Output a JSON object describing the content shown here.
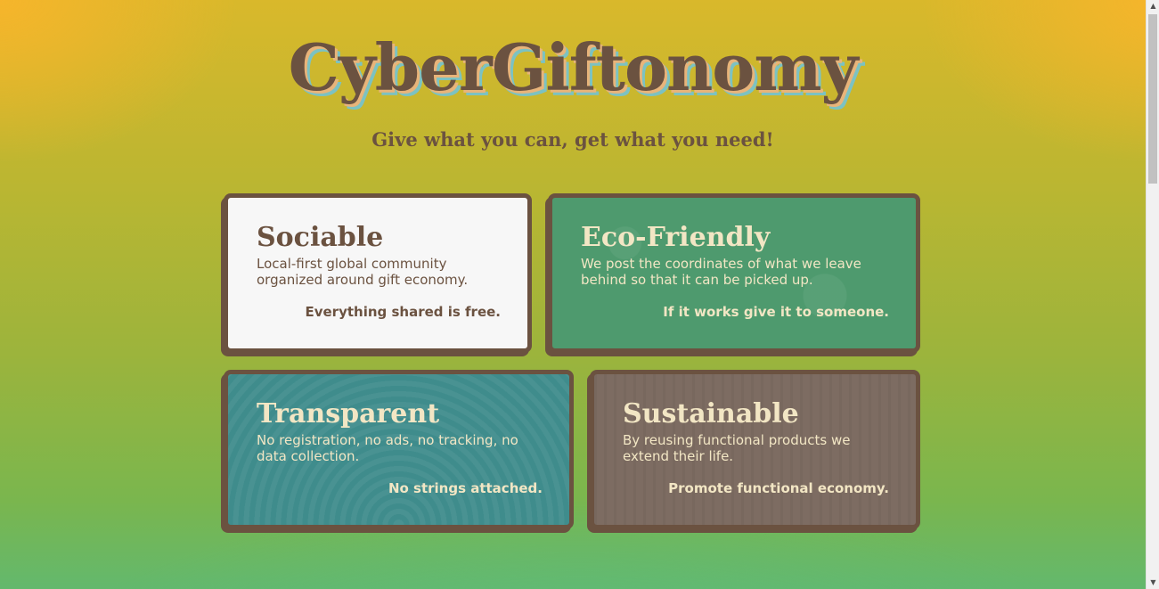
{
  "header": {
    "title": "CyberGiftonomy",
    "tagline": "Give what you can, get what you need!"
  },
  "cards": [
    {
      "title": "Sociable",
      "description": "Local-first global community organized around gift economy.",
      "motto": "Everything shared is free."
    },
    {
      "title": "Eco-Friendly",
      "description": "We post the coordinates of what we leave behind so that it can be picked up.",
      "motto": "If it works give it to someone."
    },
    {
      "title": "Transparent",
      "description": "No registration, no ads, no tracking, no data collection.",
      "motto": "No strings attached."
    },
    {
      "title": "Sustainable",
      "description": "By reusing functional products we extend their life.",
      "motto": "Promote functional economy."
    }
  ],
  "colors": {
    "text_brown": "#6b5240",
    "card_white": "#f7f7f7",
    "card_green": "#4e9a6e",
    "card_teal": "#3f8c8c",
    "card_wood": "#7d6c62",
    "card_text_light": "#f2e6c4"
  },
  "scrollbar": {
    "up_icon": "triangle-up-icon",
    "down_icon": "triangle-down-icon"
  }
}
